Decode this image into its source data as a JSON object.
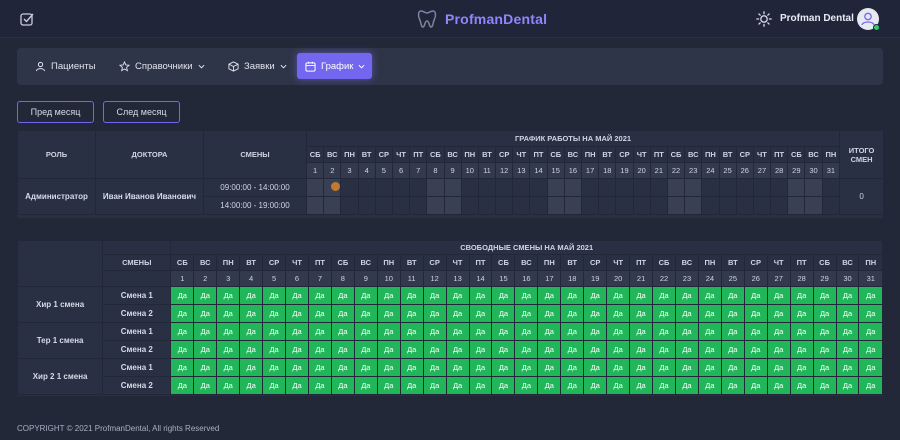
{
  "app": {
    "brand": "ProfmanDental",
    "user": "Profman Dental"
  },
  "nav": [
    {
      "label": "Пациенты",
      "icon": "user-icon"
    },
    {
      "label": "Справочники",
      "icon": "star-icon"
    },
    {
      "label": "Заявки",
      "icon": "box-icon"
    },
    {
      "label": "График",
      "icon": "calendar-icon"
    }
  ],
  "buttons": {
    "prev_month": "Пред месяц",
    "next_month": "След месяц"
  },
  "schedule": {
    "title": "ГРАФИК РАБОТЫ НА МАЙ 2021",
    "col_role": "РОЛЬ",
    "col_doctors": "ДОКТОРА",
    "col_shifts": "СМЕНЫ",
    "col_total": "ИТОГО СМЕН",
    "weekdays": [
      "СБ",
      "ВС",
      "ПН",
      "ВТ",
      "СР",
      "ЧТ",
      "ПТ",
      "СБ",
      "ВС",
      "ПН",
      "ВТ",
      "СР",
      "ЧТ",
      "ПТ",
      "СБ",
      "ВС",
      "ПН",
      "ВТ",
      "СР",
      "ЧТ",
      "ПТ",
      "СБ",
      "ВС",
      "ПН",
      "ВТ",
      "СР",
      "ЧТ",
      "ПТ",
      "СБ",
      "ВС",
      "ПН"
    ],
    "days": [
      "1",
      "2",
      "3",
      "4",
      "5",
      "6",
      "7",
      "8",
      "9",
      "10",
      "11",
      "12",
      "13",
      "14",
      "15",
      "16",
      "17",
      "18",
      "19",
      "20",
      "21",
      "22",
      "23",
      "24",
      "25",
      "26",
      "27",
      "28",
      "29",
      "30",
      "31"
    ],
    "rows": [
      {
        "role": "Администратор",
        "doctor": "Иван Иванов Иванович",
        "shifts": [
          "09:00:00 - 14:00:00",
          "14:00:00 - 19:00:00"
        ],
        "total": "0"
      }
    ]
  },
  "free": {
    "title": "СВОБОДНЫЕ СМЕНЫ НА МАЙ 2021",
    "col_shifts": "СМЕНЫ",
    "weekdays": [
      "СБ",
      "ВС",
      "ПН",
      "ВТ",
      "СР",
      "ЧТ",
      "ПТ",
      "СБ",
      "ВС",
      "ПН",
      "ВТ",
      "СР",
      "ЧТ",
      "ПТ",
      "СБ",
      "ВС",
      "ПН",
      "ВТ",
      "СР",
      "ЧТ",
      "ПТ",
      "СБ",
      "ВС",
      "ПН",
      "ВТ",
      "СР",
      "ЧТ",
      "ПТ",
      "СБ",
      "ВС",
      "ПН"
    ],
    "days": [
      "1",
      "2",
      "3",
      "4",
      "5",
      "6",
      "7",
      "8",
      "9",
      "10",
      "11",
      "12",
      "13",
      "14",
      "15",
      "16",
      "17",
      "18",
      "19",
      "20",
      "21",
      "22",
      "23",
      "24",
      "25",
      "26",
      "27",
      "28",
      "29",
      "30",
      "31"
    ],
    "cell_value": "Да",
    "groups": [
      {
        "name": "Хир 1 смена",
        "shifts": [
          "Смена 1",
          "Смена 2"
        ]
      },
      {
        "name": "Тер 1 смена",
        "shifts": [
          "Смена 1",
          "Смена 2"
        ]
      },
      {
        "name": "Хир 2 1 смена",
        "shifts": [
          "Смена 1",
          "Смена 2"
        ]
      }
    ]
  },
  "footer": "COPYRIGHT © 2021 ProfmanDental, All rights Reserved",
  "colors": {
    "accent": "#7367f0",
    "free": "#21b65a",
    "bg": "#232839"
  }
}
